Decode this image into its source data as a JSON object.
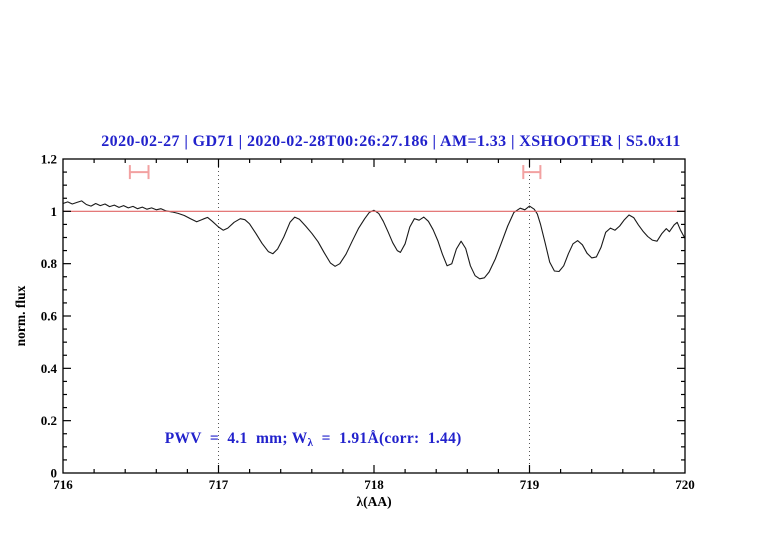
{
  "chart_data": {
    "type": "line",
    "title": "2020-02-27 | GD71 | 2020-02-28T00:26:27.186 | AM=1.33 | XSHOOTER | S5.0x11",
    "xlabel": "λ(AA)",
    "ylabel": "norm. flux",
    "xlim": [
      716,
      720
    ],
    "ylim": [
      0,
      1.2
    ],
    "grid": false,
    "legend": "none",
    "x_ticks": [
      {
        "value": 716,
        "label": "716"
      },
      {
        "value": 717,
        "label": "717"
      },
      {
        "value": 718,
        "label": "718"
      },
      {
        "value": 719,
        "label": "719"
      },
      {
        "value": 720,
        "label": "720"
      }
    ],
    "x_minor_step": 0.2,
    "y_ticks": [
      {
        "value": 0,
        "label": "0"
      },
      {
        "value": 0.2,
        "label": "0.2"
      },
      {
        "value": 0.4,
        "label": "0.4"
      },
      {
        "value": 0.6,
        "label": "0.6"
      },
      {
        "value": 0.8,
        "label": "0.8"
      },
      {
        "value": 1,
        "label": "1"
      },
      {
        "value": 1.2,
        "label": "1.2"
      }
    ],
    "y_minor_step": 0.05,
    "reference_vlines": [
      717,
      719
    ],
    "continuum_level": 1.0,
    "band_markers": [
      {
        "x1": 716.43,
        "x2": 716.55,
        "y": 1.15
      },
      {
        "x1": 718.96,
        "x2": 719.07,
        "y": 1.15
      }
    ],
    "annotation": {
      "prefix": "PWV  =  4.1  mm; W",
      "subscript": "λ",
      "suffix": "  =  1.91Å(corr:  1.44)"
    },
    "colors": {
      "title_text": "#2222cc",
      "annotation_text": "#2222cc",
      "spectrum": "#1a1a1a",
      "continuum_line": "#e06666",
      "band_marker": "#f2a1a1",
      "axis": "#000000",
      "dotted_line": "#555555",
      "background": "#ffffff"
    },
    "series": [
      {
        "name": "normalized spectrum",
        "points": [
          [
            716.0,
            1.03
          ],
          [
            716.03,
            1.036
          ],
          [
            716.06,
            1.028
          ],
          [
            716.09,
            1.034
          ],
          [
            716.12,
            1.04
          ],
          [
            716.15,
            1.026
          ],
          [
            716.18,
            1.02
          ],
          [
            716.21,
            1.03
          ],
          [
            716.24,
            1.022
          ],
          [
            716.27,
            1.028
          ],
          [
            716.3,
            1.018
          ],
          [
            716.33,
            1.024
          ],
          [
            716.36,
            1.015
          ],
          [
            716.39,
            1.022
          ],
          [
            716.42,
            1.013
          ],
          [
            716.45,
            1.019
          ],
          [
            716.48,
            1.01
          ],
          [
            716.51,
            1.016
          ],
          [
            716.54,
            1.008
          ],
          [
            716.57,
            1.013
          ],
          [
            716.6,
            1.006
          ],
          [
            716.63,
            1.01
          ],
          [
            716.66,
            1.002
          ],
          [
            716.7,
            0.998
          ],
          [
            716.74,
            0.992
          ],
          [
            716.78,
            0.984
          ],
          [
            716.82,
            0.972
          ],
          [
            716.86,
            0.96
          ],
          [
            716.9,
            0.97
          ],
          [
            716.93,
            0.977
          ],
          [
            716.96,
            0.962
          ],
          [
            717.0,
            0.94
          ],
          [
            717.03,
            0.928
          ],
          [
            717.06,
            0.936
          ],
          [
            717.1,
            0.958
          ],
          [
            717.14,
            0.972
          ],
          [
            717.17,
            0.968
          ],
          [
            717.2,
            0.952
          ],
          [
            717.24,
            0.916
          ],
          [
            717.28,
            0.878
          ],
          [
            717.32,
            0.846
          ],
          [
            717.35,
            0.838
          ],
          [
            717.38,
            0.856
          ],
          [
            717.42,
            0.902
          ],
          [
            717.46,
            0.958
          ],
          [
            717.49,
            0.978
          ],
          [
            717.52,
            0.97
          ],
          [
            717.56,
            0.944
          ],
          [
            717.6,
            0.916
          ],
          [
            717.64,
            0.884
          ],
          [
            717.68,
            0.842
          ],
          [
            717.72,
            0.802
          ],
          [
            717.75,
            0.79
          ],
          [
            717.78,
            0.8
          ],
          [
            717.82,
            0.836
          ],
          [
            717.86,
            0.886
          ],
          [
            717.9,
            0.934
          ],
          [
            717.94,
            0.972
          ],
          [
            717.97,
            0.996
          ],
          [
            718.0,
            1.004
          ],
          [
            718.03,
            0.992
          ],
          [
            718.06,
            0.962
          ],
          [
            718.09,
            0.922
          ],
          [
            718.12,
            0.88
          ],
          [
            718.15,
            0.85
          ],
          [
            718.17,
            0.843
          ],
          [
            718.2,
            0.876
          ],
          [
            718.23,
            0.94
          ],
          [
            718.26,
            0.972
          ],
          [
            718.29,
            0.966
          ],
          [
            718.32,
            0.978
          ],
          [
            718.35,
            0.962
          ],
          [
            718.38,
            0.93
          ],
          [
            718.41,
            0.888
          ],
          [
            718.44,
            0.836
          ],
          [
            718.47,
            0.792
          ],
          [
            718.5,
            0.8
          ],
          [
            718.53,
            0.856
          ],
          [
            718.56,
            0.886
          ],
          [
            718.59,
            0.858
          ],
          [
            718.62,
            0.792
          ],
          [
            718.65,
            0.754
          ],
          [
            718.68,
            0.742
          ],
          [
            718.71,
            0.746
          ],
          [
            718.74,
            0.768
          ],
          [
            718.78,
            0.818
          ],
          [
            718.82,
            0.88
          ],
          [
            718.86,
            0.944
          ],
          [
            718.9,
            0.996
          ],
          [
            718.94,
            1.012
          ],
          [
            718.97,
            1.006
          ],
          [
            719.0,
            1.02
          ],
          [
            719.03,
            1.008
          ],
          [
            719.05,
            0.99
          ],
          [
            719.07,
            0.952
          ],
          [
            719.1,
            0.88
          ],
          [
            719.13,
            0.806
          ],
          [
            719.16,
            0.772
          ],
          [
            719.19,
            0.77
          ],
          [
            719.22,
            0.792
          ],
          [
            719.25,
            0.838
          ],
          [
            719.28,
            0.876
          ],
          [
            719.31,
            0.888
          ],
          [
            719.34,
            0.872
          ],
          [
            719.37,
            0.84
          ],
          [
            719.4,
            0.822
          ],
          [
            719.43,
            0.826
          ],
          [
            719.46,
            0.862
          ],
          [
            719.49,
            0.92
          ],
          [
            719.52,
            0.936
          ],
          [
            719.55,
            0.928
          ],
          [
            719.58,
            0.944
          ],
          [
            719.61,
            0.968
          ],
          [
            719.64,
            0.986
          ],
          [
            719.67,
            0.976
          ],
          [
            719.7,
            0.948
          ],
          [
            719.73,
            0.924
          ],
          [
            719.76,
            0.904
          ],
          [
            719.79,
            0.89
          ],
          [
            719.82,
            0.886
          ],
          [
            719.85,
            0.914
          ],
          [
            719.88,
            0.934
          ],
          [
            719.9,
            0.922
          ],
          [
            719.93,
            0.948
          ],
          [
            719.95,
            0.958
          ],
          [
            719.97,
            0.93
          ],
          [
            720.0,
            0.896
          ]
        ]
      }
    ]
  }
}
